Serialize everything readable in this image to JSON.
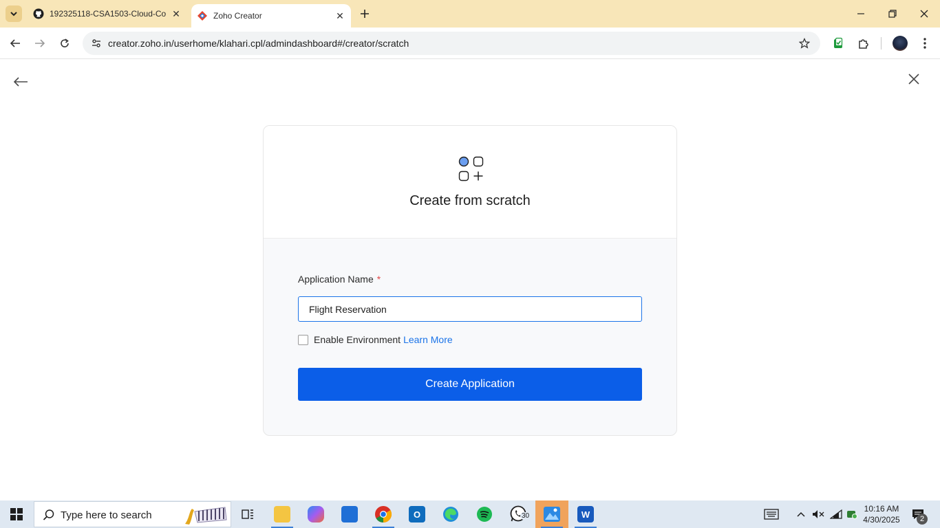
{
  "browser": {
    "tabs": [
      {
        "title": "192325118-CSA1503-Cloud-Co",
        "favicon": "github-icon",
        "active": false
      },
      {
        "title": "Zoho Creator",
        "favicon": "zoho-creator-icon",
        "active": true
      }
    ],
    "url": "creator.zoho.in/userhome/klahari.cpl/admindashboard#/creator/scratch"
  },
  "page": {
    "title": "Create from scratch",
    "form": {
      "app_name_label": "Application Name",
      "required_marker": "*",
      "app_name_value": "Flight Reservation",
      "enable_env_label": "Enable Environment",
      "learn_more": "Learn More",
      "submit_label": "Create Application"
    }
  },
  "taskbar": {
    "search_placeholder": "Type here to search",
    "whatsapp_badge": "30",
    "time": "10:16 AM",
    "date": "4/30/2025",
    "notification_count": "2"
  },
  "colors": {
    "primary": "#0b5ee8",
    "link": "#1a73e8",
    "tabstrip": "#f8e6b8",
    "required": "#e04848"
  }
}
